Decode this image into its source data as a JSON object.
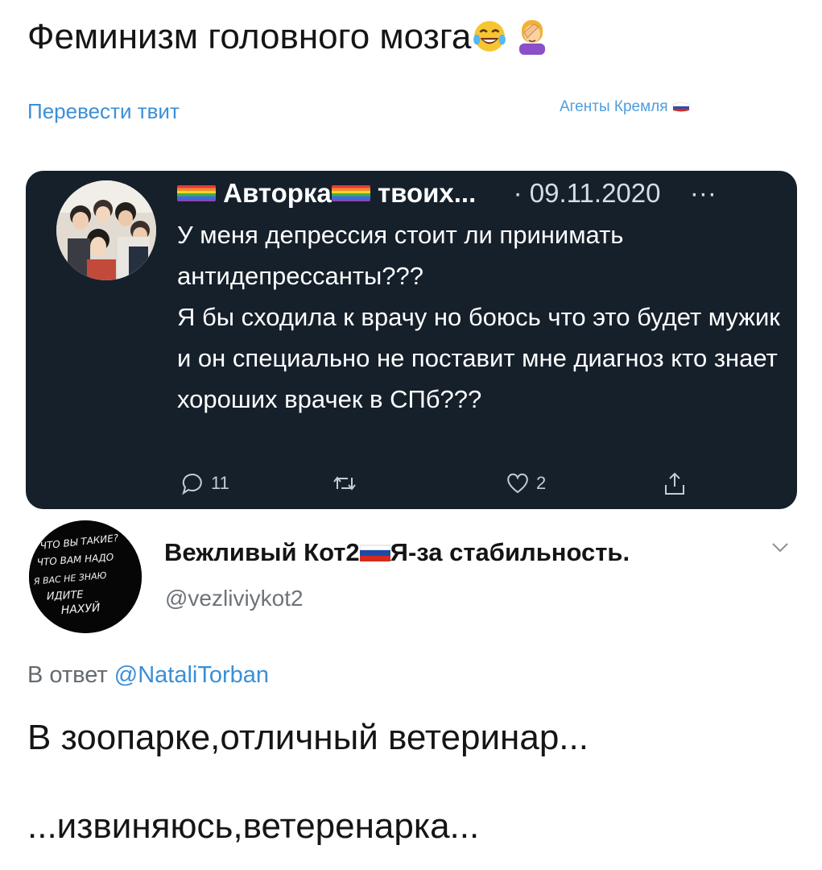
{
  "main_tweet": {
    "text": "Феминизм головного мозга",
    "emoji": [
      "laughing-tears-emoji",
      "facepalm-emoji"
    ],
    "translate_link": "Перевести твит",
    "source_label": "Агенты Кремля",
    "source_flag": "russia-flag"
  },
  "quoted_tweet": {
    "name_part1": "Авторка",
    "name_part2": "твоих...",
    "date": "· 09.11.2020",
    "menu_icon": "···",
    "text_lines": [
      "У меня депрессия стоит ли принимать антидепрессанты???",
      "Я бы сходила к врачу но боюсь что это будет мужик и он специально не поставит мне диагноз кто знает хороших врачек в СПб???"
    ],
    "replies_count": "11",
    "likes_count": "2"
  },
  "reply_tweet": {
    "name_part1": "Вежливый Кот2",
    "name_part2": "Я-за стабильность.",
    "handle": "@vezliviykot2",
    "reply_prefix": "В ответ",
    "reply_to": "@NataliTorban",
    "text_line1": "В зоопарке,отличный ветеринар...",
    "text_line2": "...извиняюсь,ветеренарка...",
    "avatar_text": [
      "ЧТО ВЫ ТАКИЕ?",
      "ЧТО ВАМ НАДО",
      "Я ВАС НЕ ЗНАЮ",
      "ИДИТЕ",
      "НАХУЙ"
    ]
  },
  "colors": {
    "card_bg": "#15202b",
    "link": "#3a8fd8",
    "muted": "#6e7379"
  }
}
